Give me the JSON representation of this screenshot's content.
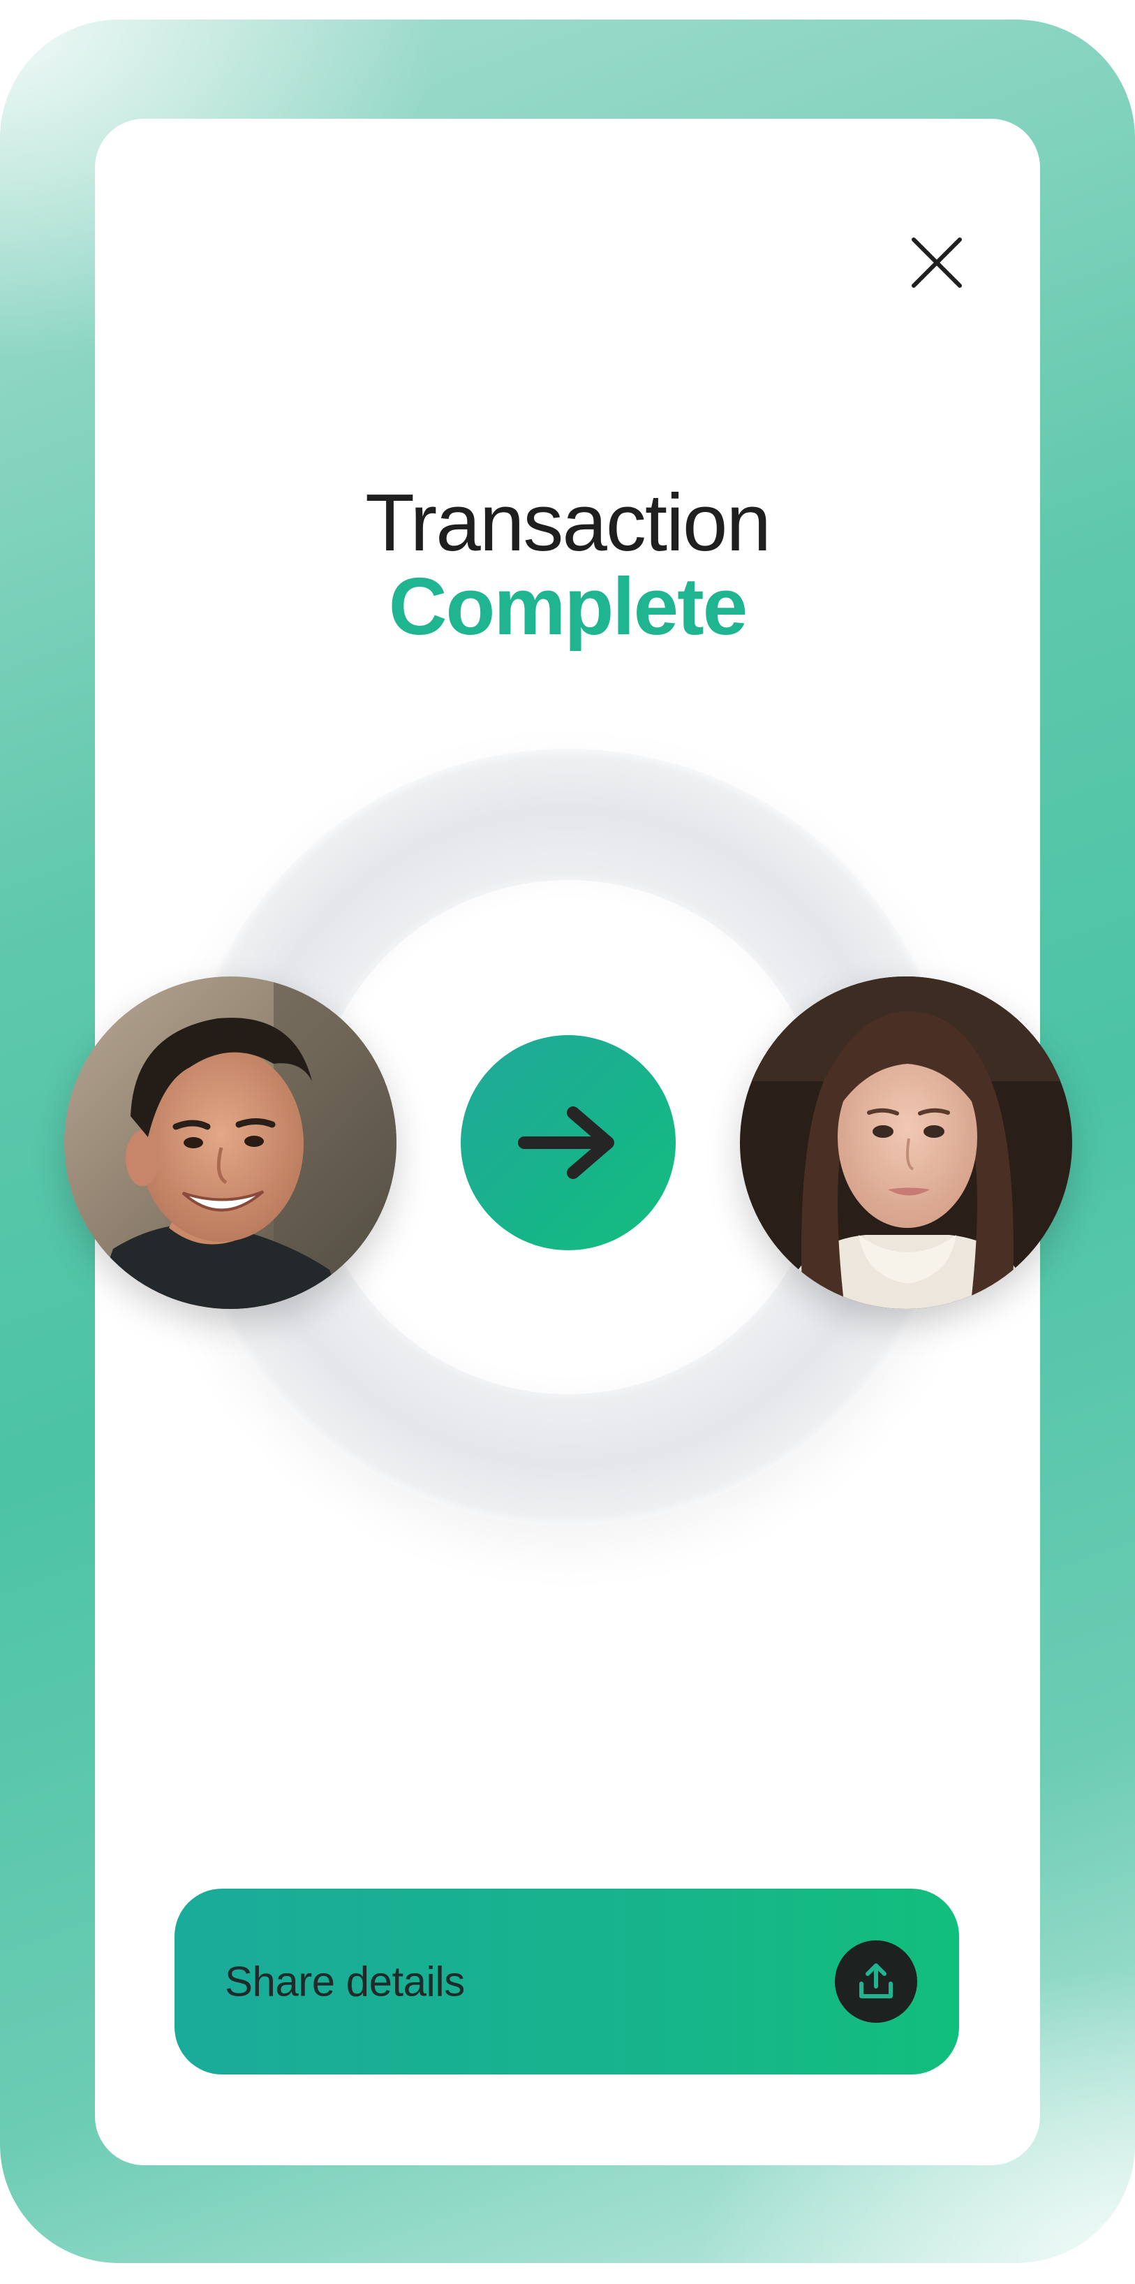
{
  "title": {
    "line1": "Transaction",
    "line2": "Complete"
  },
  "share": {
    "label": "Share details"
  },
  "colors": {
    "accent": "#1fb591",
    "gradient_start": "#1aab9a",
    "gradient_end": "#12be7c",
    "text_dark": "#1f1f1f"
  },
  "icons": {
    "close": "close-icon",
    "arrow": "arrow-right-icon",
    "share": "upload-share-icon"
  }
}
